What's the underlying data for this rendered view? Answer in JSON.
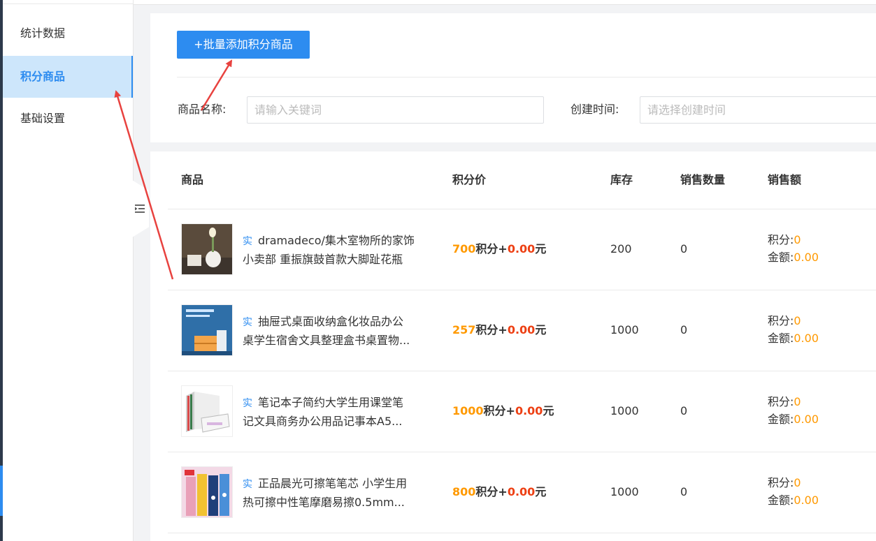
{
  "sidebar": {
    "items": [
      {
        "label": "统计数据",
        "active": false
      },
      {
        "label": "积分商品",
        "active": true
      },
      {
        "label": "基础设置",
        "active": false
      }
    ]
  },
  "toolbar": {
    "batch_add_label": "+批量添加积分商品"
  },
  "filters": {
    "name_label": "商品名称:",
    "name_placeholder": "请输入关键词",
    "time_label": "创建时间:",
    "time_placeholder": "请选择创建时间"
  },
  "table": {
    "headers": [
      "商品",
      "积分价",
      "库存",
      "销售数量",
      "销售额"
    ],
    "tag": "实",
    "points_unit": "积分+",
    "money_unit": "元",
    "sales_points_label": "积分:",
    "sales_amount_label": "金额:",
    "rows": [
      {
        "line1": "dramadeco/集木室物所的家饰",
        "line2": "小卖部 重振旗鼓首款大脚趾花瓶",
        "points": "700",
        "money": "0.00",
        "stock": "200",
        "sold": "0",
        "sales_points": "0",
        "sales_amount": "0.00"
      },
      {
        "line1": "抽屉式桌面收纳盒化妆品办公",
        "line2": "桌学生宿舍文具整理盒书桌置物...",
        "points": "257",
        "money": "0.00",
        "stock": "1000",
        "sold": "0",
        "sales_points": "0",
        "sales_amount": "0.00"
      },
      {
        "line1": "笔记本子简约大学生用课堂笔",
        "line2": "记文具商务办公用品记事本A5...",
        "points": "1000",
        "money": "0.00",
        "stock": "1000",
        "sold": "0",
        "sales_points": "0",
        "sales_amount": "0.00"
      },
      {
        "line1": "正品晨光可擦笔笔芯 小学生用",
        "line2": "热可擦中性笔摩磨易擦0.5mm...",
        "points": "800",
        "money": "0.00",
        "stock": "1000",
        "sold": "0",
        "sales_points": "0",
        "sales_amount": "0.00"
      }
    ]
  },
  "colors": {
    "primary": "#2d8cf0",
    "points": "#ff9900",
    "money": "#ed4014",
    "annotation_arrow": "#e8423f"
  }
}
